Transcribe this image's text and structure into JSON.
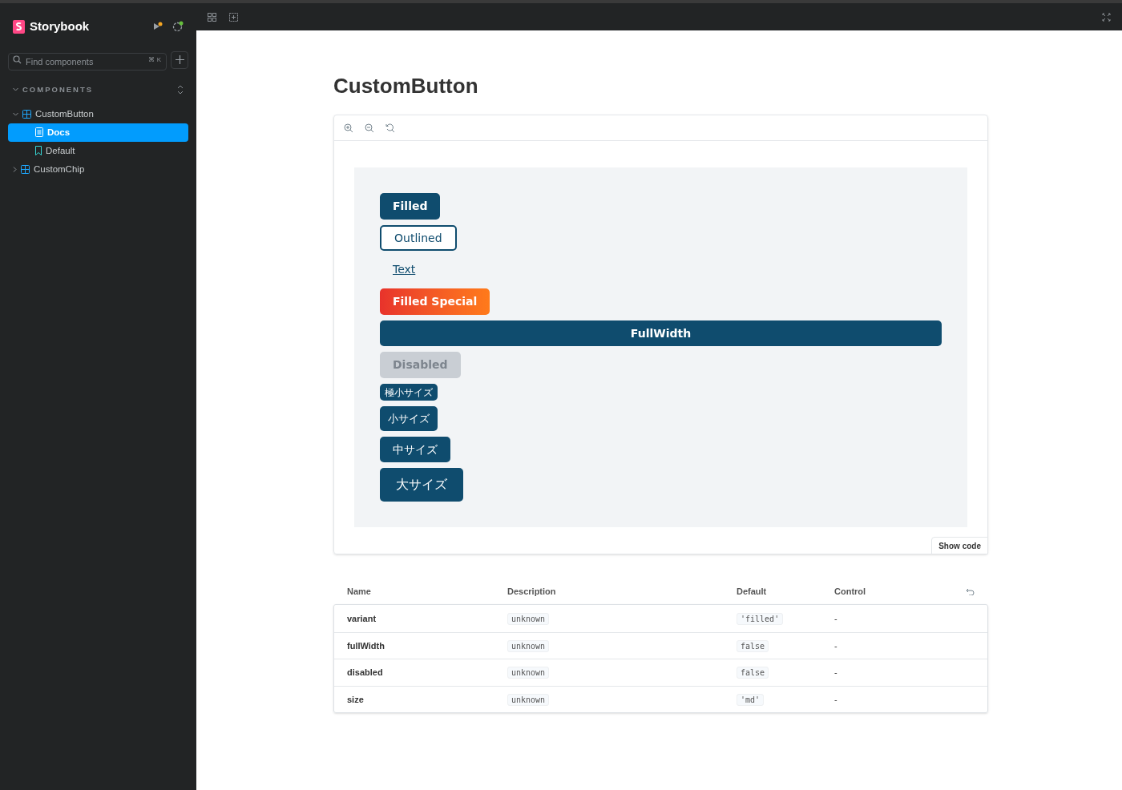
{
  "sidebar": {
    "brand": "Storybook",
    "search": {
      "placeholder": "Find components",
      "shortcut": "⌘ K"
    },
    "section": "COMPONENTS",
    "tree": [
      {
        "label": "CustomButton",
        "kind": "component",
        "expanded": true,
        "selected": false,
        "children": [
          {
            "label": "Docs",
            "kind": "docs",
            "selected": true
          },
          {
            "label": "Default",
            "kind": "story",
            "selected": false
          }
        ]
      },
      {
        "label": "CustomChip",
        "kind": "component",
        "expanded": false,
        "selected": false
      }
    ]
  },
  "page": {
    "title": "CustomButton",
    "preview_buttons": [
      {
        "label": "Filled",
        "kind": "filled"
      },
      {
        "label": "Outlined",
        "kind": "outlined"
      },
      {
        "label": "Text",
        "kind": "text"
      },
      {
        "label": "Filled Special",
        "kind": "special"
      },
      {
        "label": "FullWidth",
        "kind": "fullwidth"
      },
      {
        "label": "Disabled",
        "kind": "disabled"
      },
      {
        "label": "極小サイズ",
        "kind": "xsmall"
      },
      {
        "label": "小サイズ",
        "kind": "small"
      },
      {
        "label": "中サイズ",
        "kind": "medium"
      },
      {
        "label": "大サイズ",
        "kind": "large"
      }
    ],
    "show_code": "Show code",
    "args_table": {
      "columns": [
        "Name",
        "Description",
        "Default",
        "Control"
      ],
      "rows": [
        {
          "name": "variant",
          "description": "unknown",
          "default": "'filled'",
          "control": "-"
        },
        {
          "name": "fullWidth",
          "description": "unknown",
          "default": "false",
          "control": "-"
        },
        {
          "name": "disabled",
          "description": "unknown",
          "default": "false",
          "control": "-"
        },
        {
          "name": "size",
          "description": "unknown",
          "default": "'md'",
          "control": "-"
        }
      ]
    }
  }
}
